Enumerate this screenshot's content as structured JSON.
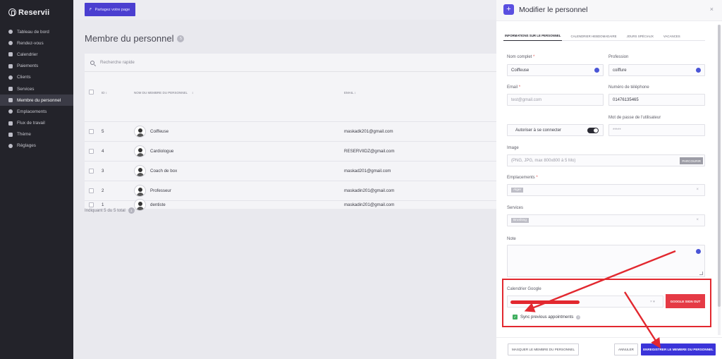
{
  "app": {
    "name": "Reservii"
  },
  "topbar": {
    "share_label": "Partagez votre page"
  },
  "sidebar": {
    "items": [
      {
        "label": "Tableau de bord",
        "icon": "dashboard-icon"
      },
      {
        "label": "Rendez-vous",
        "icon": "calendar-check-icon"
      },
      {
        "label": "Calendrier",
        "icon": "calendar-icon"
      },
      {
        "label": "Paiements",
        "icon": "payment-icon"
      },
      {
        "label": "Clients",
        "icon": "users-icon"
      },
      {
        "label": "Services",
        "icon": "services-icon"
      },
      {
        "label": "Membre du personnel",
        "icon": "staff-icon",
        "active": true
      },
      {
        "label": "Emplacements",
        "icon": "location-icon"
      },
      {
        "label": "Flux de travail",
        "icon": "workflow-icon"
      },
      {
        "label": "Thème",
        "icon": "brush-icon"
      },
      {
        "label": "Réglages",
        "icon": "gear-icon"
      }
    ]
  },
  "main": {
    "title": "Membre du personnel",
    "count": "5",
    "search_placeholder": "Recherche rapide",
    "columns": {
      "id": "ID",
      "name": "Nom du membre du personnel",
      "email": "Email"
    },
    "rows": [
      {
        "id": "5",
        "name": "Coiffeuse",
        "email": "maskadk201@gmail.com"
      },
      {
        "id": "4",
        "name": "Cardiologue",
        "email": "RESERVIIDZ@gmail.com"
      },
      {
        "id": "3",
        "name": "Coach de box",
        "email": "maskad201@gmail.com"
      },
      {
        "id": "2",
        "name": "Professeur",
        "email": "maskadin201@gmail.com"
      },
      {
        "id": "1",
        "name": "dentiste",
        "email": "maskadin201@gmail.com"
      }
    ],
    "footer_text": "Indiquant 5 du 5 total",
    "footer_badge": "1"
  },
  "modal": {
    "title": "Modifier le personnel",
    "close": "×",
    "tabs": [
      {
        "label": "Informations sur le personnel",
        "active": true
      },
      {
        "label": "Calendrier hebdomadaire"
      },
      {
        "label": "Jours spéciaux"
      },
      {
        "label": "Vacances"
      }
    ],
    "fields": {
      "full_name": {
        "label": "Nom complet",
        "value": "Coiffeuse"
      },
      "profession": {
        "label": "Profession",
        "value": "coiffure"
      },
      "email": {
        "label": "Email",
        "value": "test@gmail.com"
      },
      "phone": {
        "label": "Numéro de téléphone",
        "value": "01476135465"
      },
      "allow_login": {
        "label": "Autoriser à se connecter",
        "on": true
      },
      "password": {
        "label": "Mot de passe de l'utilisateur",
        "value": "*****"
      },
      "image": {
        "label": "Image",
        "placeholder": "(PNG, JPG, max 800x800 à 5 Mo)",
        "browse": "PARCOURIR"
      },
      "locations": {
        "label": "Emplacements",
        "chip": "Alger"
      },
      "services": {
        "label": "Services",
        "chip": "Brushing"
      },
      "note": {
        "label": "Note",
        "value": ""
      },
      "google": {
        "label": "Calendrier Google",
        "sign_out": "Google sign out",
        "sync_label": "Sync previous appointments",
        "sync_checked": true
      }
    },
    "footer": {
      "hide_label": "Masquer le membre du personnel",
      "cancel_label": "Annuler",
      "save_label": "Enregistrer le membre du personnel"
    }
  },
  "colors": {
    "primary": "#3b34d9",
    "danger": "#e53a45",
    "annotation": "#e2282f",
    "sidebar_bg": "#23232a"
  }
}
